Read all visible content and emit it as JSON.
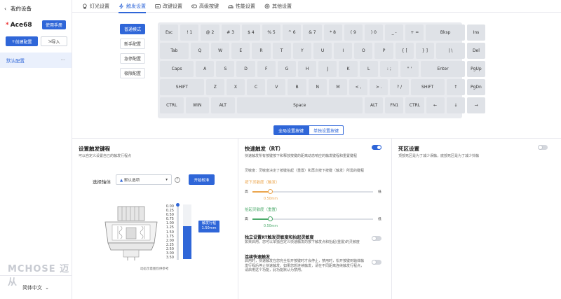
{
  "sidebar": {
    "back_title": "我的设备",
    "device_name": "Ace68",
    "manual_label": "使用手册",
    "create_label": "创建配置",
    "import_label": "导入",
    "profile_label": "默认配置",
    "profile_more": "···",
    "brand": "MCHOSE 迈从",
    "language": "简体中文"
  },
  "tabs": [
    {
      "label": "灯光设置",
      "icon": "lightbulb-icon"
    },
    {
      "label": "触发设置",
      "icon": "lightning-icon"
    },
    {
      "label": "改键设置",
      "icon": "keyboard-icon"
    },
    {
      "label": "高级按键",
      "icon": "gamepad-icon"
    },
    {
      "label": "性能设置",
      "icon": "gauge-icon"
    },
    {
      "label": "其他设置",
      "icon": "gear-icon"
    }
  ],
  "active_tab": 1,
  "modes": [
    "普通模式",
    "新手配置",
    "急停配置",
    "极限配置"
  ],
  "active_mode": 0,
  "keyboard": {
    "rows": [
      [
        [
          "Esc",
          1
        ],
        [
          "! 1",
          1
        ],
        [
          "@ 2",
          1
        ],
        [
          "# 3",
          1
        ],
        [
          "$ 4",
          1
        ],
        [
          "% 5",
          1
        ],
        [
          "^ 6",
          1
        ],
        [
          "& 7",
          1
        ],
        [
          "* 8",
          1
        ],
        [
          "( 9",
          1
        ],
        [
          ") 0",
          1
        ],
        [
          "_ -",
          1
        ],
        [
          "+ =",
          1
        ],
        [
          "Bksp",
          2
        ],
        [
          "Ins",
          1
        ]
      ],
      [
        [
          "Tab",
          1.5
        ],
        [
          "Q",
          1
        ],
        [
          "W",
          1
        ],
        [
          "E",
          1
        ],
        [
          "R",
          1
        ],
        [
          "T",
          1
        ],
        [
          "Y",
          1
        ],
        [
          "U",
          1
        ],
        [
          "I",
          1
        ],
        [
          "O",
          1
        ],
        [
          "P",
          1
        ],
        [
          "{ [",
          1
        ],
        [
          "} ]",
          1
        ],
        [
          "| \\",
          1.5
        ],
        [
          "Del",
          1
        ]
      ],
      [
        [
          "Caps",
          1.75
        ],
        [
          "A",
          1
        ],
        [
          "S",
          1
        ],
        [
          "D",
          1
        ],
        [
          "F",
          1
        ],
        [
          "G",
          1
        ],
        [
          "H",
          1
        ],
        [
          "J",
          1
        ],
        [
          "K",
          1
        ],
        [
          "L",
          1
        ],
        [
          ": ;",
          1
        ],
        [
          "\" '",
          1
        ],
        [
          "Enter",
          2.25
        ],
        [
          "PgUp",
          1
        ]
      ],
      [
        [
          "SHIFT",
          2.25
        ],
        [
          "Z",
          1
        ],
        [
          "X",
          1
        ],
        [
          "C",
          1
        ],
        [
          "V",
          1
        ],
        [
          "B",
          1
        ],
        [
          "N",
          1
        ],
        [
          "M",
          1
        ],
        [
          "< ,",
          1
        ],
        [
          "> .",
          1
        ],
        [
          "? /",
          1
        ],
        [
          "SHIFT",
          1.75
        ],
        [
          "↑",
          1
        ],
        [
          "PgDn",
          1
        ]
      ],
      [
        [
          "CTRL",
          1.25
        ],
        [
          "WIN",
          1.25
        ],
        [
          "ALT",
          1.25
        ],
        [
          "Space",
          6.25
        ],
        [
          "ALT",
          1
        ],
        [
          "FN1",
          1
        ],
        [
          "CTRL",
          1
        ],
        [
          "←",
          1
        ],
        [
          "↓",
          1
        ],
        [
          "→",
          1
        ]
      ]
    ]
  },
  "segment": {
    "global": "全局设置按键",
    "single": "单独设置按键"
  },
  "trigger_panel": {
    "title": "设置触发键程",
    "subtitle": "可以自定义设置自己的触发行程点",
    "axis_label": "选择轴体",
    "axis_value": "默认选项",
    "help": "?",
    "calibrate": "开始校准",
    "scale": [
      "0.00",
      "0.25",
      "0.50",
      "0.75",
      "1.00",
      "1.25",
      "1.50",
      "1.75",
      "2.00",
      "2.25",
      "2.50",
      "3.00",
      "3.50"
    ],
    "tooltip_title": "触发行程",
    "tooltip_value": "1.50mm",
    "travel_fraction": 0.6,
    "caption": "动态示意图仅供参考"
  },
  "rt_panel": {
    "title": "快速触发（RT）",
    "subtitle": "快速触发所有按键按下和释放按键的距离动态响应的触发键程和重置键程",
    "note": "灵敏度：灵敏度决定了按键抬起（重置）和再次按下按键（触发）所需的键程",
    "press_label": "按下灵敏度（触发）",
    "press_value": "0.50mm",
    "release_label": "抬起灵敏度（重置）",
    "release_value": "0.50mm",
    "high": "高",
    "low": "低",
    "press_fraction": 0.1,
    "release_fraction": 0.1,
    "enabled": true,
    "separate_title": "独立设置RT触发灵敏度和抬起灵敏度",
    "separate_desc": "如果启用，您可以单独自定义快速触发的按下触发点和抬起(重置)的灵敏度",
    "separate_enabled": false,
    "continuous_title": "连续快速触发",
    "continuous_desc": "启用时，快速触发在您完全松开按键时才会停止，禁用时，松开按键到轴体触发行程后停止快速触发。如果您想连续触发，请在不同距离连续触发行程点，请启用这个功能，此功能默认为禁用。",
    "continuous_enabled": false
  },
  "dead_panel": {
    "title": "死区设置",
    "subtitle": "顶部死区是为了减少误触，底部死区是为了减少抖触",
    "enabled": false
  },
  "colors": {
    "accent": "#2f66d8",
    "press": "#eba54d",
    "release": "#4caa6b"
  }
}
